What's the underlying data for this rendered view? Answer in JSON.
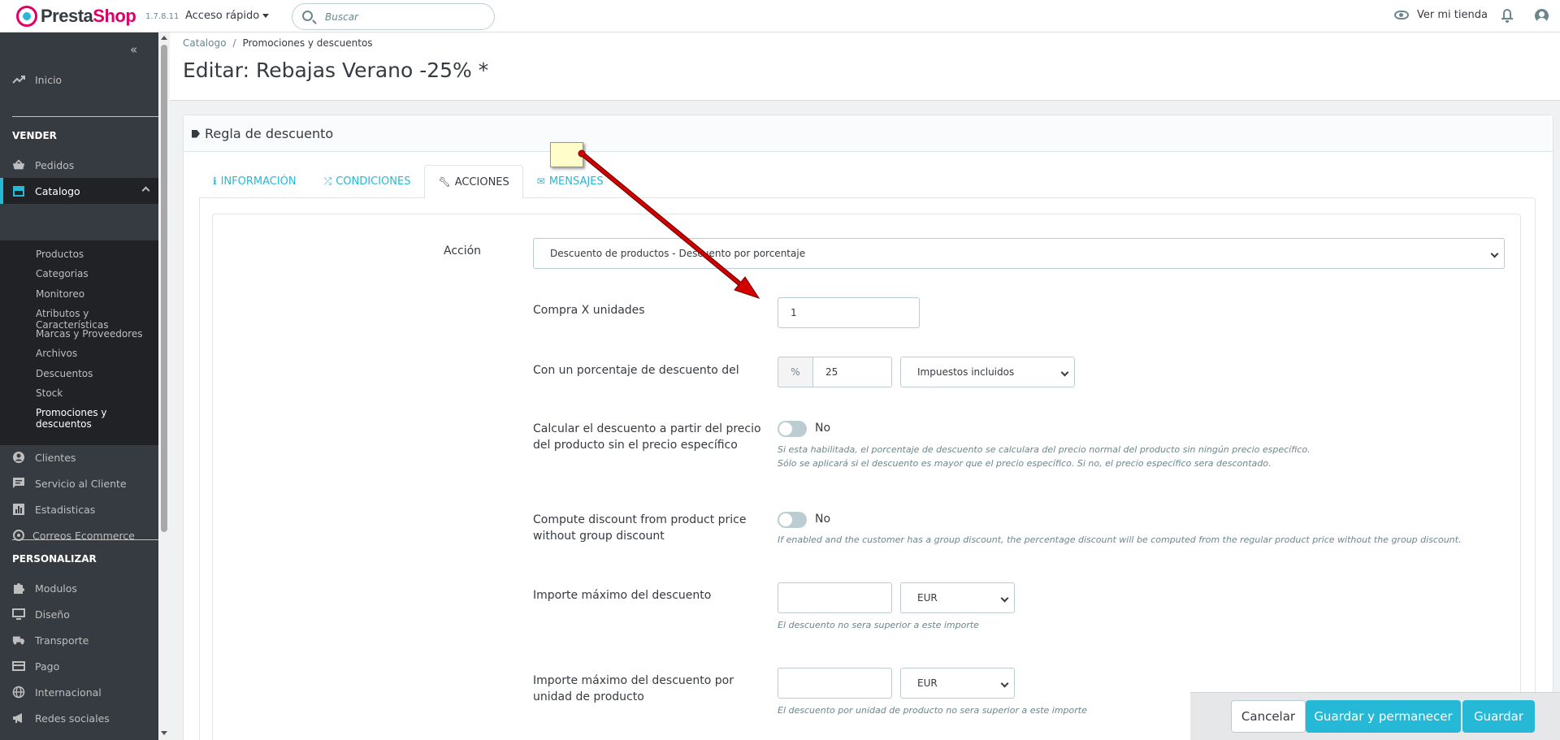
{
  "header": {
    "logo_word1": "Presta",
    "logo_word2": "Shop",
    "version": "1.7.8.11",
    "quick_access": "Acceso rápido",
    "search_placeholder": "Buscar",
    "view_store": "Ver mi tienda"
  },
  "sidebar": {
    "home": "Inicio",
    "section_sell": "VENDER",
    "orders": "Pedidos",
    "catalog": "Catalogo",
    "catalog_items": [
      "Productos",
      "Categorias",
      "Monitoreo",
      "Atributos y Características",
      "Marcas y Proveedores",
      "Archivos",
      "Descuentos",
      "Stock",
      "Promociones y",
      "descuentos"
    ],
    "customers": "Clientes",
    "customer_service": "Servicio al Cliente",
    "stats": "Estadisticas",
    "ecommerce_mail": "Correos Ecommerce",
    "section_customize": "PERSONALIZAR",
    "modules": "Modulos",
    "design": "Diseño",
    "shipping": "Transporte",
    "payment": "Pago",
    "international": "Internacional",
    "social": "Redes sociales"
  },
  "breadcrumb": {
    "parent": "Catalogo",
    "separator": "/",
    "current": "Promociones y descuentos"
  },
  "page": {
    "title": "Editar: Rebajas Verano -25% *"
  },
  "panel": {
    "title": "Regla de descuento",
    "tabs": [
      {
        "label": "INFORMACIÓN",
        "icon": "info-icon"
      },
      {
        "label": "CONDICIONES",
        "icon": "shuffle-icon"
      },
      {
        "label": "ACCIONES",
        "icon": "wrench-icon"
      },
      {
        "label": "MENSAJES",
        "icon": "envelope-icon"
      }
    ],
    "active_tab": "ACCIONES"
  },
  "form": {
    "action_label": "Acción",
    "action_value": "Descuento de productos - Descuento por porcentaje",
    "buy_units_label": "Compra X unidades",
    "buy_units_value": "1",
    "percent_label": "Con un porcentaje de descuento del",
    "percent_addon": "%",
    "percent_value": "25",
    "tax_value": "Impuestos incluidos",
    "calc_label_1": "Calcular el descuento a partir del precio",
    "calc_label_2": "del producto sin el precio específico",
    "calc_switch": "No",
    "calc_help_1": "Si esta habilitada, el porcentaje de descuento se calculara del precio normal del producto sin ningún precio específico.",
    "calc_help_2": "Sólo se aplicará si el descuento es mayor que el precio específico. Si no, el precio específico sera descontado.",
    "group_label_1": "Compute discount from product price",
    "group_label_2": "without group discount",
    "group_switch": "No",
    "group_help": "If enabled and the customer has a group discount, the percentage discount will be computed from the regular product price without the group discount.",
    "max_label": "Importe máximo del descuento",
    "max_value": "",
    "max_currency": "EUR",
    "max_help": "El descuento no sera superior a este importe",
    "max_unit_label_1": "Importe máximo del descuento por",
    "max_unit_label_2": "unidad de producto",
    "max_unit_value": "",
    "max_unit_currency": "EUR",
    "max_unit_help": "El descuento por unidad de producto no sera superior a este importe"
  },
  "footer": {
    "cancel": "Cancelar",
    "save_stay": "Guardar y permanecer",
    "save": "Guardar"
  },
  "colors": {
    "accent": "#25b9d7",
    "brand_pink": "#df0067",
    "sidebar_bg": "#363a41",
    "annotation_arrow": "#d40000"
  }
}
